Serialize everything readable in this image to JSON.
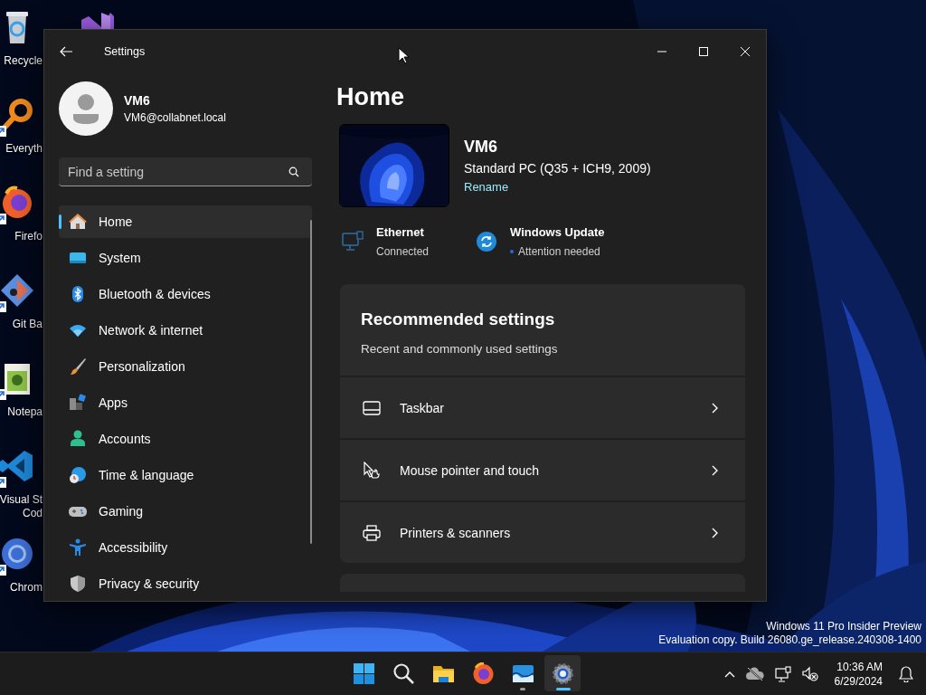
{
  "desktop_icons": [
    {
      "kind": "recycle",
      "lines": [
        "Recycle"
      ],
      "shortcut": false
    },
    {
      "kind": "vs",
      "shortcut": false
    },
    {
      "kind": "everything",
      "lines": [
        "Everyth"
      ],
      "shortcut": true
    },
    {
      "kind": "firefox",
      "lines": [
        "Firefo"
      ],
      "shortcut": true
    },
    {
      "kind": "gitbash",
      "lines": [
        "Git Ba"
      ],
      "shortcut": true
    },
    {
      "kind": "notepad",
      "lines": [
        "Notepa"
      ],
      "shortcut": true
    },
    {
      "kind": "vscode",
      "lines": [
        "Visual St",
        "Cod"
      ],
      "shortcut": true
    },
    {
      "kind": "chrome",
      "lines": [
        "Chrom"
      ],
      "shortcut": true
    }
  ],
  "desktop_notice": [
    "Windows 11 Pro Insider Preview",
    "Evaluation copy. Build 26080.ge_release.240308-1400"
  ],
  "window": {
    "title": "Settings"
  },
  "user": {
    "name": "VM6",
    "email": "VM6@collabnet.local"
  },
  "search": {
    "placeholder": "Find a setting"
  },
  "nav": [
    {
      "kind": "home",
      "label": "Home",
      "selected": true
    },
    {
      "kind": "system",
      "label": "System",
      "selected": false
    },
    {
      "kind": "bluetooth",
      "label": "Bluetooth & devices",
      "selected": false
    },
    {
      "kind": "network",
      "label": "Network & internet",
      "selected": false
    },
    {
      "kind": "personalization",
      "label": "Personalization",
      "selected": false
    },
    {
      "kind": "apps",
      "label": "Apps",
      "selected": false
    },
    {
      "kind": "accounts",
      "label": "Accounts",
      "selected": false
    },
    {
      "kind": "time",
      "label": "Time & language",
      "selected": false
    },
    {
      "kind": "gaming",
      "label": "Gaming",
      "selected": false
    },
    {
      "kind": "accessibility",
      "label": "Accessibility",
      "selected": false
    },
    {
      "kind": "privacy",
      "label": "Privacy & security",
      "selected": false
    }
  ],
  "page": {
    "title": "Home"
  },
  "device": {
    "name": "VM6",
    "model": "Standard PC (Q35 + ICH9, 2009)",
    "rename": "Rename"
  },
  "status": [
    {
      "kind": "ethernet",
      "title": "Ethernet",
      "detail": "Connected",
      "alert": false
    },
    {
      "kind": "update",
      "title": "Windows Update",
      "detail": "Attention needed",
      "alert": true
    }
  ],
  "recommended": {
    "title": "Recommended settings",
    "subtitle": "Recent and commonly used settings",
    "rows": [
      {
        "kind": "taskbar",
        "label": "Taskbar"
      },
      {
        "kind": "pointer",
        "label": "Mouse pointer and touch"
      },
      {
        "kind": "printer",
        "label": "Printers & scanners"
      }
    ]
  },
  "taskbar": {
    "apps": [
      {
        "kind": "start",
        "running": false,
        "active": false
      },
      {
        "kind": "search",
        "running": false,
        "active": false
      },
      {
        "kind": "explorer",
        "running": false,
        "active": false
      },
      {
        "kind": "firefox",
        "running": false,
        "active": false
      },
      {
        "kind": "photos",
        "running": true,
        "active": false
      },
      {
        "kind": "settings",
        "running": true,
        "active": true
      }
    ],
    "clock": {
      "time": "10:36 AM",
      "date": "6/29/2024"
    }
  }
}
